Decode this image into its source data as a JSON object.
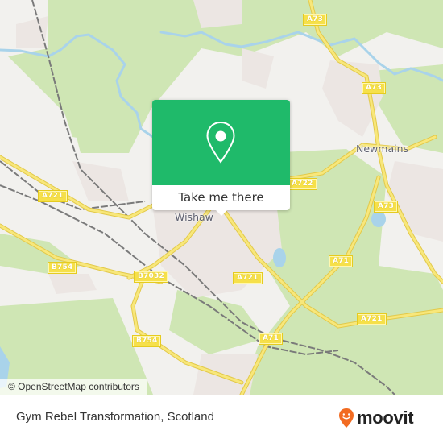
{
  "map": {
    "attribution": "© OpenStreetMap contributors",
    "colors": {
      "background": "#f2f1ee",
      "woodland": "#cfe6b4",
      "urban": "#ece6e3",
      "water": "#a9d3ea",
      "road_major": "#f3dc5c",
      "railway": "#7a7a7a",
      "popup_green": "#1fba6a"
    },
    "place_labels": [
      {
        "name": "Wishaw"
      },
      {
        "name": "Newmains"
      }
    ],
    "road_labels": [
      {
        "ref": "A73"
      },
      {
        "ref": "A73"
      },
      {
        "ref": "A73"
      },
      {
        "ref": "A721"
      },
      {
        "ref": "A722"
      },
      {
        "ref": "B754"
      },
      {
        "ref": "B7032"
      },
      {
        "ref": "A721"
      },
      {
        "ref": "A71"
      },
      {
        "ref": "A721"
      },
      {
        "ref": "A71"
      },
      {
        "ref": "B754"
      }
    ]
  },
  "popup": {
    "icon": "location-pin-icon",
    "button_label": "Take me there"
  },
  "footer": {
    "place_title": "Gym Rebel Transformation, Scotland",
    "brand": "moovit",
    "brand_color": "#f26b21"
  }
}
